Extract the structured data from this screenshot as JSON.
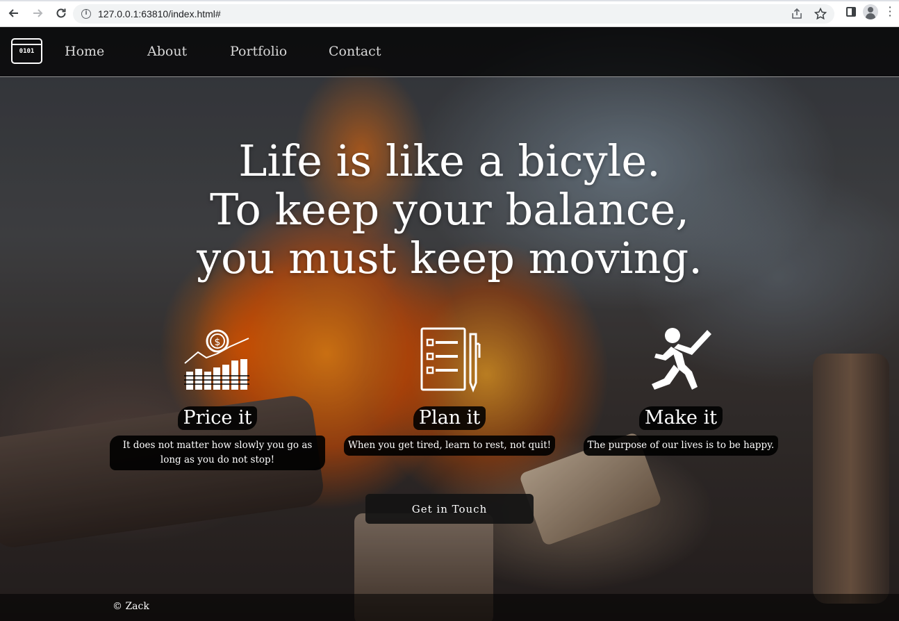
{
  "browser": {
    "url": "127.0.0.1:63810/index.html#",
    "back_icon": "arrow-left-icon",
    "forward_icon": "arrow-right-icon",
    "reload_icon": "reload-icon",
    "share_icon": "share-icon",
    "bookmark_icon": "star-icon",
    "side_panel_icon": "side-panel-icon",
    "profile_icon": "avatar-icon",
    "menu_icon": "kebab-menu-icon"
  },
  "site_nav": {
    "logo_text": "0101",
    "links": [
      "Home",
      "About",
      "Portfolio",
      "Contact"
    ]
  },
  "hero": {
    "lines": [
      "Life is like a bicyle.",
      "To keep your balance,",
      "you must keep moving."
    ]
  },
  "features": [
    {
      "icon": "money-chart-icon",
      "title": "Price it",
      "desc": "It does not matter how slowly you go as long as you do not stop!"
    },
    {
      "icon": "checklist-pen-icon",
      "title": "Plan it",
      "desc": "When you get tired, learn to rest, not quit!"
    },
    {
      "icon": "runner-icon",
      "title": "Make it",
      "desc": "The purpose of our lives is to be happy."
    }
  ],
  "cta": {
    "label": "Get in Touch"
  },
  "footer": {
    "text": "© Zack"
  },
  "colors": {
    "text": "#ffffff",
    "nav_bg": "#000000",
    "accent_fire": "#ff8c14"
  }
}
